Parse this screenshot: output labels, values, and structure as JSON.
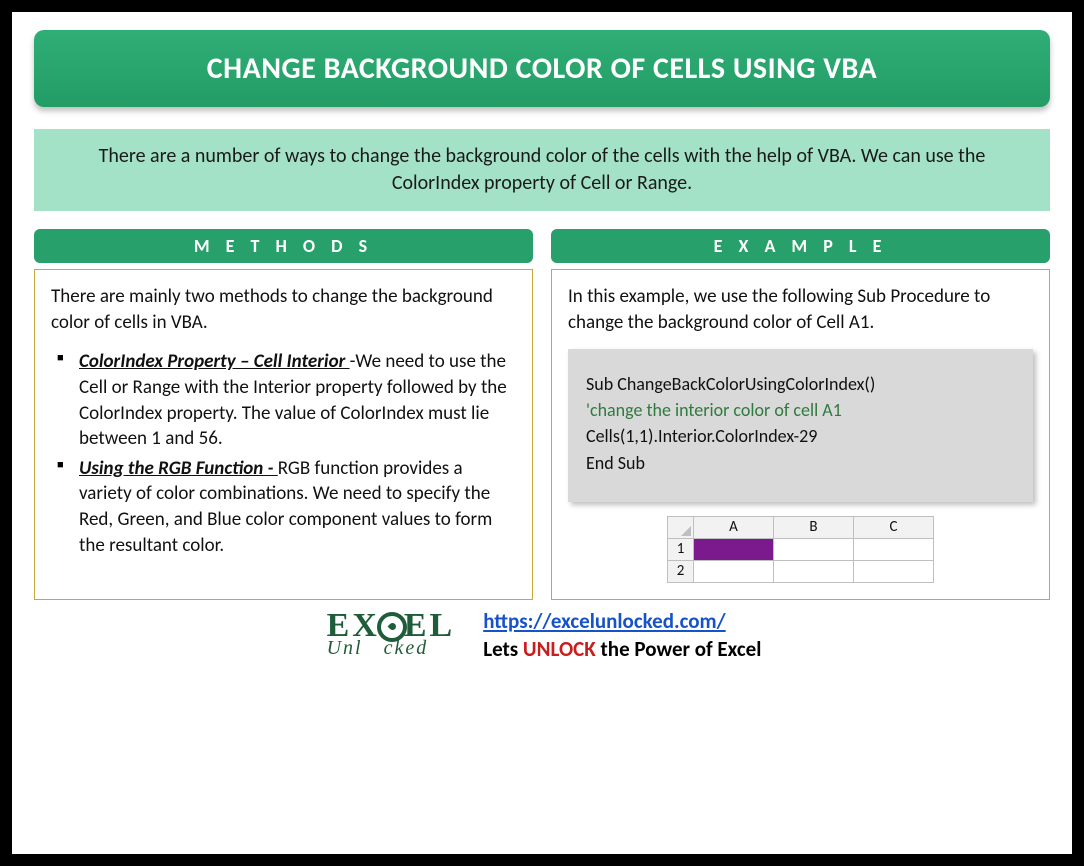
{
  "title": "CHANGE BACKGROUND COLOR OF CELLS USING VBA",
  "intro": "There are a number of ways to change the background color of the cells with the help of VBA. We can use the ColorIndex property of Cell or Range.",
  "columns": {
    "methods": {
      "heading": "M E T H O D S",
      "lead": "There are mainly two methods to change the background color of cells in VBA.",
      "items": [
        {
          "term": "ColorIndex Property – Cell Interior ",
          "sep": "-",
          "desc": "We need to use the Cell or Range with the Interior property followed by the ColorIndex property. The value of ColorIndex must lie between 1 and 56."
        },
        {
          "term": "Using the RGB Function - ",
          "sep": "",
          "desc": "RGB function provides a variety of color combinations. We need to specify the Red, Green, and Blue color component values to form the resultant color."
        }
      ]
    },
    "example": {
      "heading": "E X A M P L E",
      "lead": "In this example, we use the following Sub Procedure to change the background color of Cell A1.",
      "code": {
        "l1": "Sub ChangeBackColorUsingColorIndex()",
        "l2": "'change the interior color of cell A1",
        "l3": "Cells(1,1).Interior.ColorIndex-29",
        "l4": "End Sub"
      },
      "sheet": {
        "cols": [
          "A",
          "B",
          "C"
        ],
        "rows": [
          "1",
          "2"
        ],
        "highlight_cell": "A1",
        "highlight_color": "#7a1a8c"
      }
    }
  },
  "footer": {
    "logo_top": "EX   EL",
    "logo_bottom": "Unl   cked",
    "url": "https://excelunlocked.com/",
    "tagline_pre": "Lets ",
    "tagline_bold": "UNLOCK",
    "tagline_post": " the Power of Excel"
  }
}
